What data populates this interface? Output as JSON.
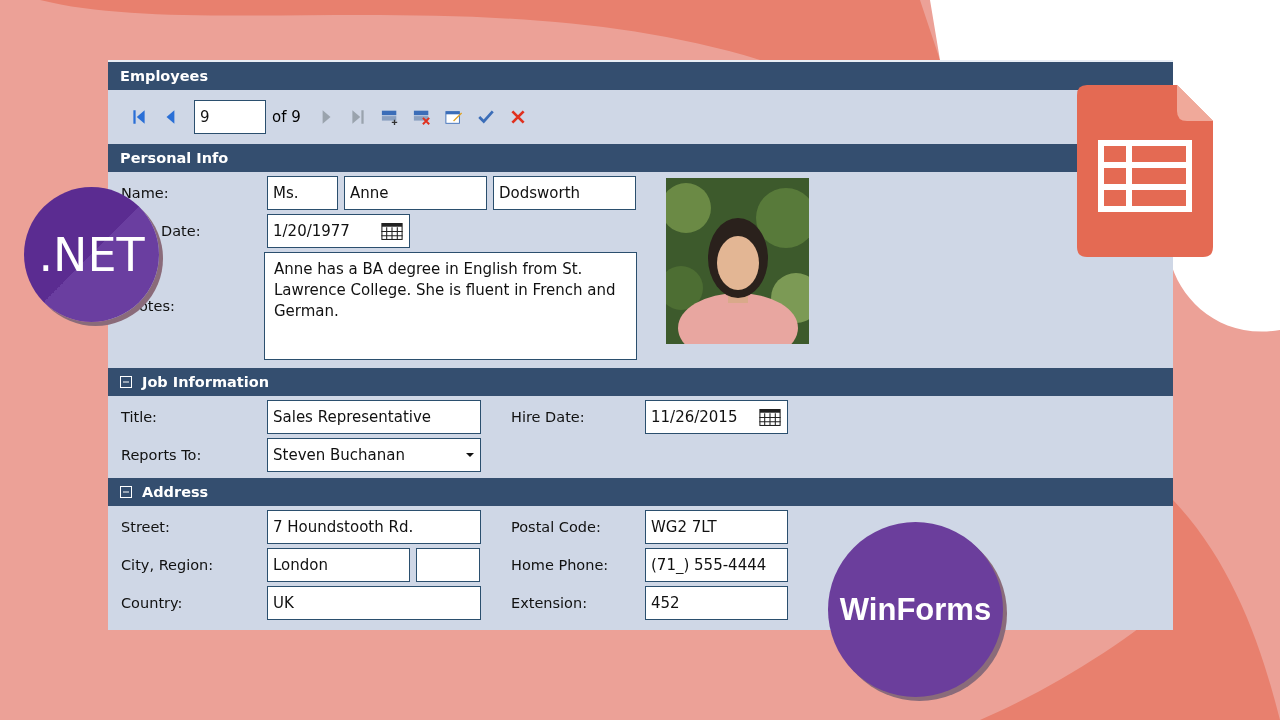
{
  "window": {
    "title": "Employees"
  },
  "navigator": {
    "items": [
      {
        "kind": "first",
        "disabled": false
      },
      {
        "kind": "prev",
        "disabled": false
      },
      {
        "kind": "position",
        "value": "9"
      },
      {
        "kind": "count",
        "text": "of 9"
      },
      {
        "kind": "next",
        "disabled": true
      },
      {
        "kind": "last",
        "disabled": true
      },
      {
        "kind": "add"
      },
      {
        "kind": "delete"
      },
      {
        "kind": "edit"
      },
      {
        "kind": "save"
      },
      {
        "kind": "cancel"
      }
    ]
  },
  "personal": {
    "title": "Personal Info",
    "name_label": "Name:",
    "title_value": "Ms.",
    "first_name": "Anne",
    "last_name": "Dodsworth",
    "birth_label": "Date:",
    "birth_date": "1/20/1977",
    "notes_label": "otes:",
    "notes": "Anne has a BA degree in English from St. Lawrence College.  She is fluent in French and German."
  },
  "job": {
    "title": "Job Information",
    "expanded": true,
    "fields": [
      {
        "label": "Title:",
        "value": "Sales Representative",
        "kind": "text"
      },
      {
        "label": "Hire Date:",
        "value": "11/26/2015",
        "kind": "date"
      },
      {
        "label": "Reports To:",
        "value": "Steven Buchanan",
        "kind": "combo"
      }
    ]
  },
  "address": {
    "title": "Address",
    "expanded": true,
    "fields": [
      {
        "label": "Street:",
        "value": "7 Houndstooth Rd.",
        "kind": "text"
      },
      {
        "label": "Postal Code:",
        "value": "WG2 7LT",
        "kind": "text"
      },
      {
        "label": "City, Region:",
        "value": "London",
        "kind": "pair"
      },
      {
        "label": "Home Phone:",
        "value": "(71_) 555-4444",
        "kind": "text"
      },
      {
        "label": "Country:",
        "value": "UK",
        "kind": "text"
      },
      {
        "label": "Extension:",
        "value": "452",
        "kind": "text"
      }
    ]
  },
  "badges": {
    "dotnet": ".NET",
    "winforms": "WinForms"
  }
}
